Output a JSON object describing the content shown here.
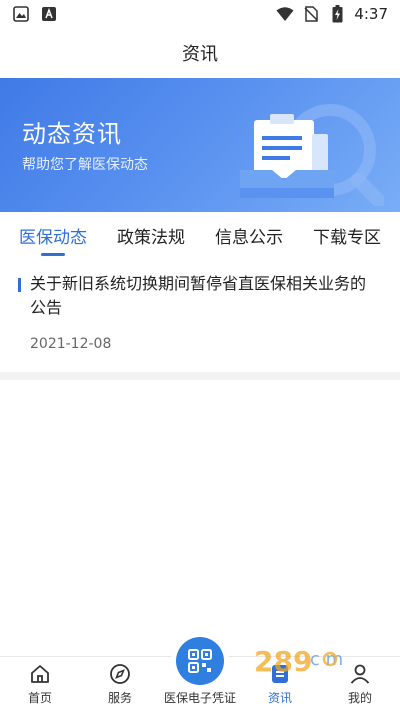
{
  "status_bar": {
    "time": "4:37"
  },
  "nav": {
    "title": "资讯"
  },
  "banner": {
    "title": "动态资讯",
    "subtitle": "帮助您了解医保动态"
  },
  "tabs": [
    {
      "label": "医保动态",
      "active": true
    },
    {
      "label": "政策法规",
      "active": false
    },
    {
      "label": "信息公示",
      "active": false
    },
    {
      "label": "下载专区",
      "active": false
    }
  ],
  "news": [
    {
      "title": "关于新旧系统切换期间暂停省直医保相关业务的公告",
      "date": "2021-12-08"
    }
  ],
  "bottom_nav": [
    {
      "label": "首页",
      "icon": "home-icon",
      "active": false
    },
    {
      "label": "服务",
      "icon": "compass-icon",
      "active": false
    },
    {
      "label": "医保电子凭证",
      "icon": "qr-code-icon",
      "active": false
    },
    {
      "label": "资讯",
      "icon": "news-icon",
      "active": true
    },
    {
      "label": "我的",
      "icon": "user-icon",
      "active": false
    }
  ],
  "colors": {
    "accent": "#2f6fd6",
    "banner_start": "#3f7ae6",
    "banner_end": "#79adf6"
  }
}
